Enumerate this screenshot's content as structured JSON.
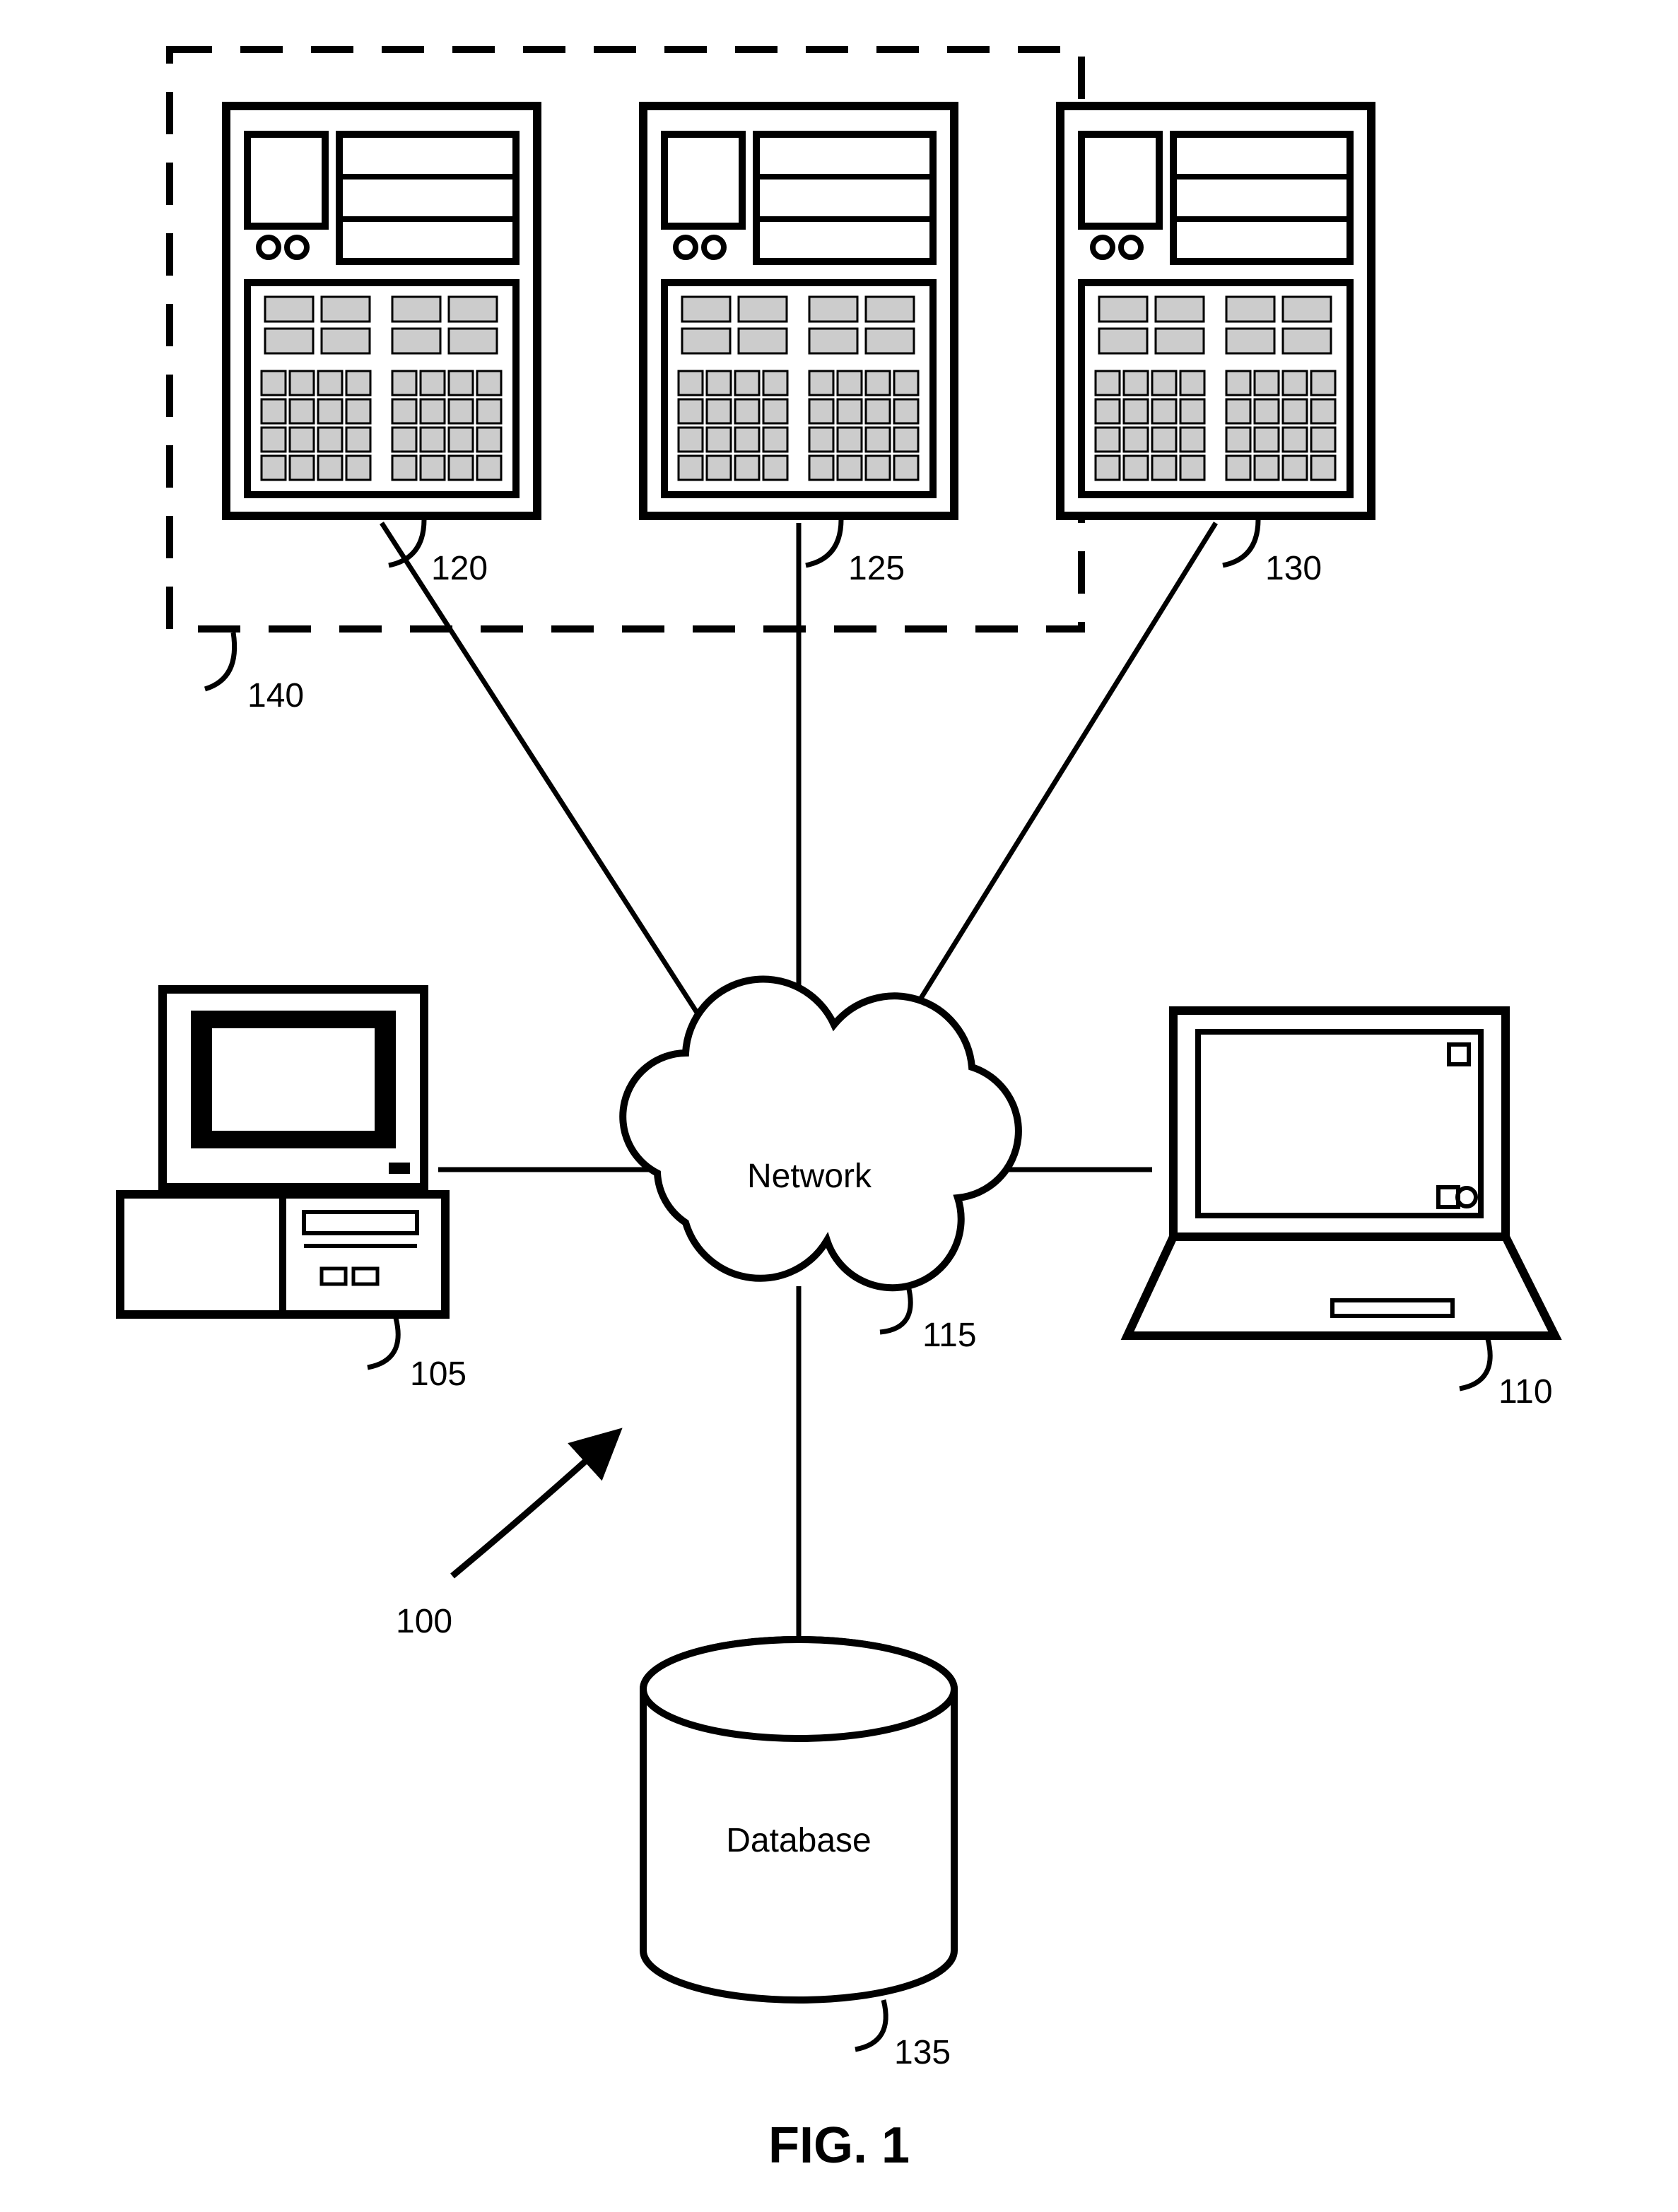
{
  "figure_label": "FIG. 1",
  "refs": {
    "system": "100",
    "pc": "105",
    "laptop": "110",
    "network": "115",
    "server_a": "120",
    "server_b": "125",
    "server_c": "130",
    "database": "135",
    "cluster": "140"
  },
  "labels": {
    "network": "Network",
    "database": "Database"
  }
}
